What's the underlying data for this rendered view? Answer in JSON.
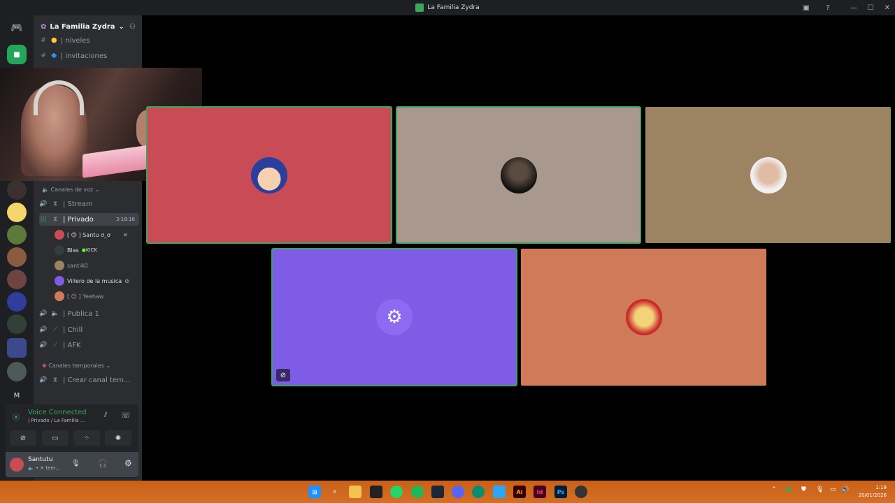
{
  "window": {
    "title": "La Familia Zydra"
  },
  "server": {
    "name": "La Familia Zydra"
  },
  "text_channels": [
    {
      "label": "| niveles",
      "emoji": "🟡"
    },
    {
      "label": "| invitaciones",
      "emoji": "🔷"
    }
  ],
  "voice_category": "Canales de voz",
  "voice_channels": [
    {
      "label": "| Stream"
    },
    {
      "label": "| Privado",
      "timer": "3:18:18"
    },
    {
      "label": "| Publica 1"
    },
    {
      "label": "| Chill"
    },
    {
      "label": "| AFK"
    }
  ],
  "voice_users": [
    {
      "name": "[ 😊 ] Santu ơ_ơ",
      "color": "#dbdee1"
    },
    {
      "name": "Blas",
      "tag": "KICK",
      "color": "#dbdee1"
    },
    {
      "name": "santi40",
      "color": "#949ba4"
    },
    {
      "name": "Villero de la musica",
      "color": "#dbdee1"
    },
    {
      "name": "[ 😊 ] Yeehaw",
      "color": "#949ba4"
    }
  ],
  "temp_category": "Canales temporales",
  "temp_channel": "| Crear canal tem...",
  "voice_panel": {
    "status": "Voice Connected",
    "location": "| Privado / La Familia ...",
    "user": "Santutu",
    "user_status": "🔈 • ✕ tem..."
  },
  "tiles": [
    {
      "name": "stan-avatar-tile",
      "bg": "#c94b55",
      "speaking": true
    },
    {
      "name": "fighter-avatar-tile",
      "bg": "#a8988e",
      "speaking": true
    },
    {
      "name": "guy-avatar-tile",
      "bg": "#9c8361",
      "speaking": false
    },
    {
      "name": "bot-avatar-tile",
      "bg": "#7f5ce6",
      "speaking": true
    },
    {
      "name": "blonde-avatar-tile",
      "bg": "#cf7a58",
      "speaking": false
    }
  ],
  "colors": {
    "accent": "#3ba55d",
    "taskbar": "#d4651a",
    "sidebar": "#2b2d31",
    "rail": "#1e1f22"
  },
  "clock": {
    "time": "1:19",
    "date": "20/01/2026"
  }
}
